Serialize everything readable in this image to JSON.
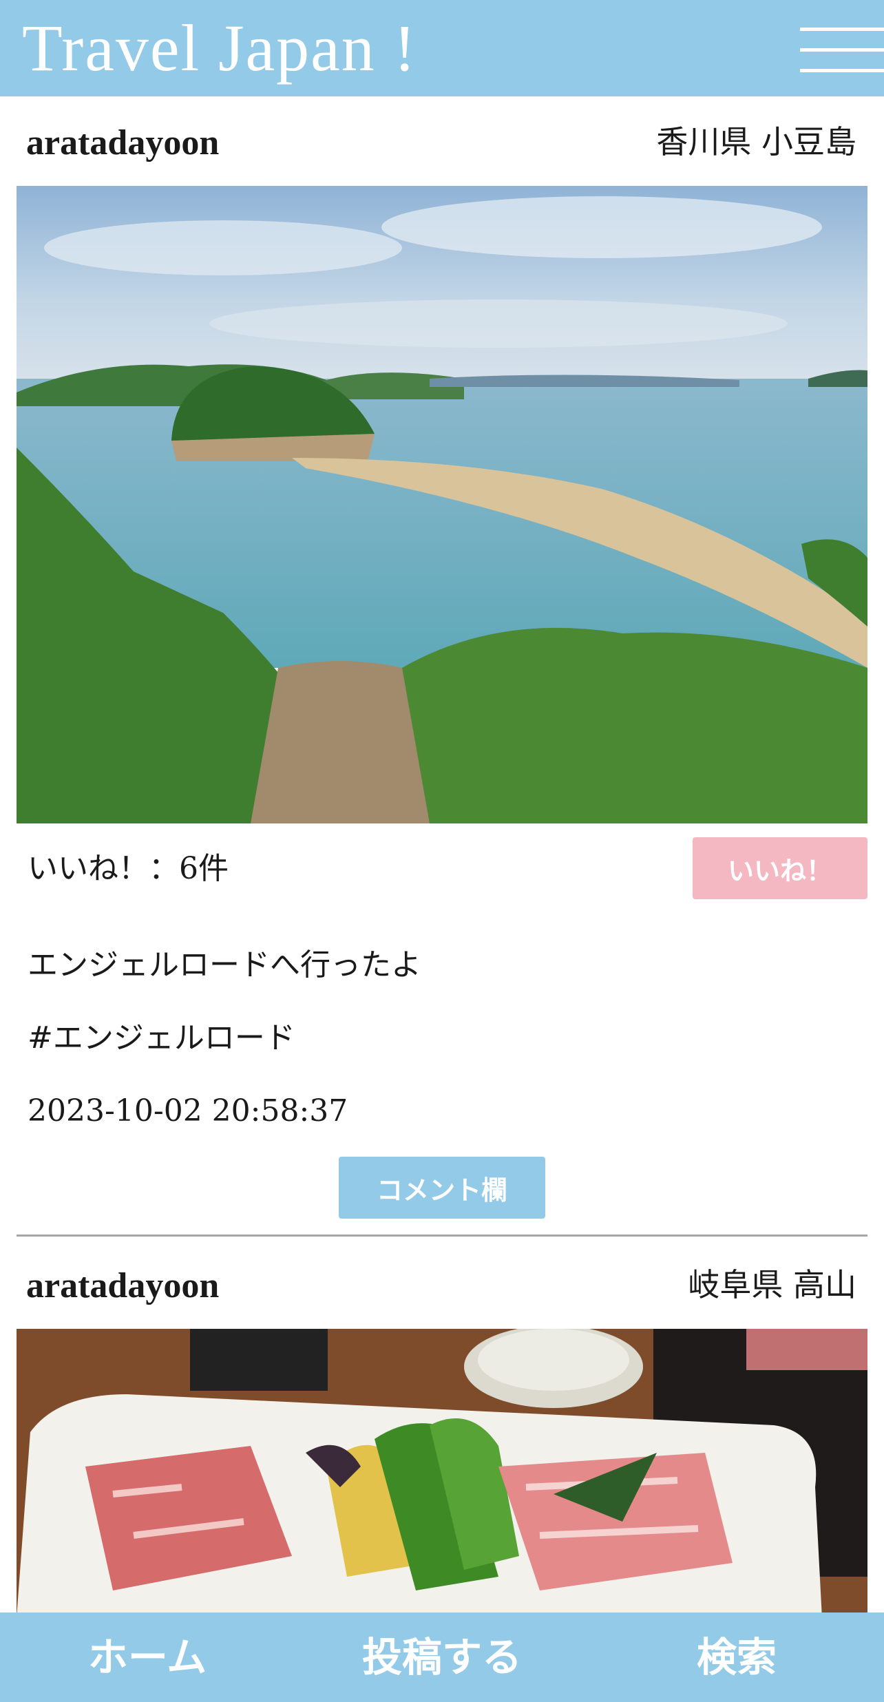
{
  "header": {
    "title": "Travel Japan !",
    "menu_icon": "hamburger-menu-icon"
  },
  "posts": [
    {
      "username": "aratadayoon",
      "location": "香川県 小豆島",
      "likes_text": "いいね！：6件",
      "like_button": "いいね！",
      "caption": "エンジェルロードへ行ったよ",
      "hashtag": "#エンジェルロード",
      "timestamp": "2023-10-02 20:58:37",
      "comment_button": "コメント欄"
    },
    {
      "username": "aratadayoon",
      "location": "岐阜県 高山"
    }
  ],
  "nav": {
    "home": "ホーム",
    "post": "投稿する",
    "search": "検索"
  },
  "colors": {
    "brand": "#93cae8",
    "like": "#f3b8c2",
    "divider": "#a6a6a6"
  }
}
